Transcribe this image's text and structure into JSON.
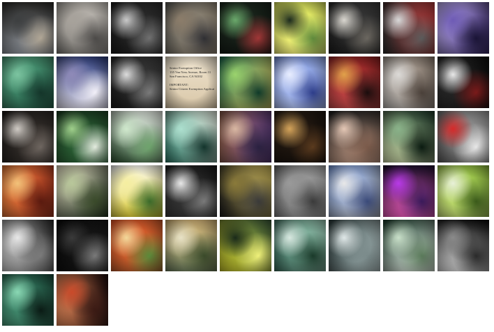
{
  "gallery": {
    "tiles": [
      {
        "id": "raspberry-pi-boards",
        "colors": [
          "#8a8f96",
          "#3d3f40",
          "#b0a695",
          "#2b2a28"
        ]
      },
      {
        "id": "microphone-stand",
        "colors": [
          "#7d7a75",
          "#a7a29b",
          "#4c4a48",
          "#c9c4bd"
        ]
      },
      {
        "id": "person-with-mask",
        "colors": [
          "#1a1a1a",
          "#c9c9c9",
          "#707070",
          "#2d2d2d"
        ]
      },
      {
        "id": "blurred-lights",
        "colors": [
          "#5b5a55",
          "#8c7d6a",
          "#2f2f33",
          "#a89a84"
        ]
      },
      {
        "id": "cocktail-glasses",
        "colors": [
          "#1d2a1f",
          "#6aa86b",
          "#a03737",
          "#0f1410"
        ]
      },
      {
        "id": "green-boots",
        "colors": [
          "#d9e35c",
          "#1c2a1d",
          "#5f8a3c",
          "#f2f07a"
        ]
      },
      {
        "id": "living-room",
        "colors": [
          "#3a3a3a",
          "#d9d6cf",
          "#6b6760",
          "#1d1d1d"
        ]
      },
      {
        "id": "mixing-console",
        "colors": [
          "#b63b3b",
          "#d8d8d8",
          "#5b5b5b",
          "#2a2a2a"
        ]
      },
      {
        "id": "purple-room",
        "colors": [
          "#3b2a6b",
          "#6e5bb5",
          "#1a1436",
          "#b7a8e8"
        ]
      },
      {
        "id": "green-chairs",
        "colors": [
          "#2b6b52",
          "#7cc4a0",
          "#14352a",
          "#4e9b78"
        ]
      },
      {
        "id": "pen-on-graph-paper",
        "colors": [
          "#dcd9e8",
          "#8f8ab8",
          "#f2f0f8",
          "#2a3a7b"
        ]
      },
      {
        "id": "game-character",
        "colors": [
          "#1a1a1a",
          "#dcdcdc",
          "#7a7a7a",
          "#3a3a3a"
        ]
      },
      {
        "id": "tax-document",
        "colors": [
          "#d9c7a8",
          "#efe4cf",
          "#6b5a42",
          "#b8a07c"
        ],
        "text": "Senior Exemption Office\n135 Van Ness Avenue, Room 11\nSan Francisco, CA 94102\n\nIMPORTANT:\nSenior Citizen Exemption Application"
      },
      {
        "id": "spreadsheet-screen",
        "colors": [
          "#1f6b4e",
          "#9bd36d",
          "#0f3a2a",
          "#e5d46a"
        ]
      },
      {
        "id": "white-blossom-tree",
        "colors": [
          "#7a92d9",
          "#e9eeff",
          "#2d3d8a",
          "#b8c8f5"
        ]
      },
      {
        "id": "red-room-tv",
        "colors": [
          "#8a1f1f",
          "#e0a14a",
          "#1a0d0d",
          "#c94b4b"
        ]
      },
      {
        "id": "white-appliances",
        "colors": [
          "#8a7b6e",
          "#dcdad7",
          "#4a4039",
          "#b8b4b0"
        ]
      },
      {
        "id": "piano-keys",
        "colors": [
          "#0d0d0d",
          "#e8e8e8",
          "#7a1a1a",
          "#2b2b2b"
        ]
      },
      {
        "id": "guitar-neck",
        "colors": [
          "#3a3430",
          "#cfcac4",
          "#6e6660",
          "#1b1816"
        ]
      },
      {
        "id": "seaweed-salad",
        "colors": [
          "#2f6b3a",
          "#9fcf8b",
          "#e3ebde",
          "#1a3a20"
        ]
      },
      {
        "id": "teacup",
        "colors": [
          "#2b4f2f",
          "#cfe8cc",
          "#6ea36c",
          "#f1f6ef"
        ]
      },
      {
        "id": "toy-figure",
        "colors": [
          "#2f7a68",
          "#ade0cf",
          "#13342c",
          "#e7efe3"
        ]
      },
      {
        "id": "wine-glass",
        "colors": [
          "#8a5b4a",
          "#d8b7a2",
          "#2a2140",
          "#5a3a78"
        ]
      },
      {
        "id": "beer-bottles",
        "colors": [
          "#2a1e14",
          "#d4a35a",
          "#5a3a1e",
          "#0f0b08"
        ]
      },
      {
        "id": "portrait-face",
        "colors": [
          "#1a1a1a",
          "#e4c7b5",
          "#7a5a4a",
          "#c9a08a"
        ]
      },
      {
        "id": "bass-guitar",
        "colors": [
          "#1d3a2a",
          "#8ab38a",
          "#0a1a10",
          "#cdd9a8"
        ]
      },
      {
        "id": "red-outdoor-chairs",
        "colors": [
          "#9a9a9a",
          "#d62a2a",
          "#e8e8e8",
          "#5a5a5a"
        ]
      },
      {
        "id": "soup-bowl",
        "colors": [
          "#a8371f",
          "#f2c27a",
          "#5a1a0f",
          "#e27a3a"
        ]
      },
      {
        "id": "sake-bottles",
        "colors": [
          "#1a2a1a",
          "#b8c79a",
          "#3a4a2a",
          "#e8e2c6"
        ]
      },
      {
        "id": "yellow-fruit",
        "colors": [
          "#d8c72a",
          "#f5eea0",
          "#3a6a2a",
          "#ffffff"
        ]
      },
      {
        "id": "infrared-trees",
        "colors": [
          "#3a3a3a",
          "#e8e8e8",
          "#7a7a7a",
          "#1a1a1a"
        ]
      },
      {
        "id": "synthesizer",
        "colors": [
          "#1a1a1a",
          "#8a7a3a",
          "#3a3a3a",
          "#c9b45a"
        ]
      },
      {
        "id": "rainy-window",
        "colors": [
          "#6a6a6a",
          "#9a9a9a",
          "#3a3a3a",
          "#b4b4b4"
        ]
      },
      {
        "id": "city-building",
        "colors": [
          "#7a9ad9",
          "#e8e8e8",
          "#3a4a7a",
          "#b8b8b8"
        ]
      },
      {
        "id": "stage-performer",
        "colors": [
          "#1a0f2a",
          "#b83ae8",
          "#3a1a5a",
          "#e85ab8"
        ]
      },
      {
        "id": "green-screen",
        "colors": [
          "#8ab83a",
          "#e8f0d8",
          "#3a5a1a",
          "#c9e07a"
        ]
      },
      {
        "id": "keyboard-white",
        "colors": [
          "#2a2a2a",
          "#e8e8e8",
          "#7a7a7a",
          "#c9c9c9"
        ]
      },
      {
        "id": "amplifier",
        "colors": [
          "#1a1a1a",
          "#3a3a3a",
          "#7a7a7a",
          "#0a0a0a"
        ]
      },
      {
        "id": "noodle-plate",
        "colors": [
          "#a85a2a",
          "#f2d89a",
          "#5a8a3a",
          "#e85a2a"
        ]
      },
      {
        "id": "dumpling-plate",
        "colors": [
          "#6a7a5a",
          "#e8e2c6",
          "#3a4a2a",
          "#d8b87a"
        ]
      },
      {
        "id": "device-on-yellow",
        "colors": [
          "#c9c72a",
          "#1a2a1a",
          "#eef07a",
          "#3a5a3a"
        ]
      },
      {
        "id": "pen-on-document",
        "colors": [
          "#3a6a5a",
          "#d8e8e0",
          "#1a3a2a",
          "#9ac9b4"
        ]
      },
      {
        "id": "printed-page",
        "colors": [
          "#2a3a3a",
          "#e0e8e8",
          "#7a8a8a",
          "#b4c4c4"
        ]
      },
      {
        "id": "stacked-paper",
        "colors": [
          "#1a3a2a",
          "#c9e0c9",
          "#5a7a5a",
          "#e8f0e8"
        ]
      },
      {
        "id": "dark-stairs",
        "colors": [
          "#0a0a0a",
          "#8a8a8a",
          "#2a2a2a",
          "#d8d8d8"
        ]
      },
      {
        "id": "green-curves",
        "colors": [
          "#1a4a3a",
          "#8ad8b4",
          "#0a1a14",
          "#4a9a7a"
        ]
      },
      {
        "id": "concert-crowd",
        "colors": [
          "#1a0a0a",
          "#c94a2a",
          "#3a1a14",
          "#e88a5a"
        ]
      }
    ]
  }
}
